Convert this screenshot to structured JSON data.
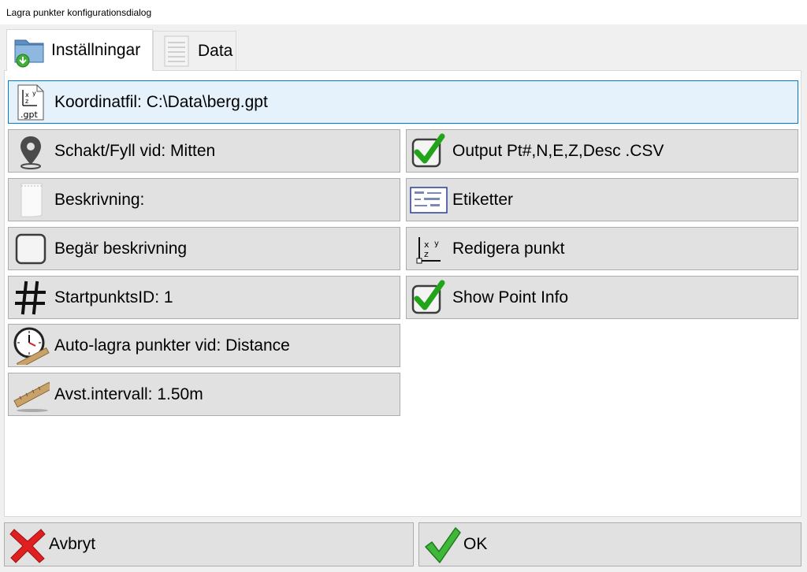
{
  "window": {
    "title": "Lagra punkter konfigurationsdialog"
  },
  "tabs": [
    {
      "label": "Inställningar",
      "icon": "folder-download-icon",
      "active": true
    },
    {
      "label": "Data",
      "icon": "data-sheet-icon",
      "active": false
    }
  ],
  "settings": {
    "coordinate_file": {
      "label": "Koordinatfil: C:\\Data\\berg.gpt",
      "icon": "gpt-file-icon",
      "icon_text": ".gpt"
    },
    "cut_fill": {
      "label": "Schakt/Fyll vid: Mitten",
      "icon": "map-pin-icon"
    },
    "description": {
      "label": "Beskrivning:",
      "icon": "note-page-icon"
    },
    "request_description": {
      "label": "Begär beskrivning",
      "icon": "checkbox-icon",
      "checked": false
    },
    "start_point_id": {
      "label": "StartpunktsID: 1",
      "icon": "hash-icon"
    },
    "auto_store": {
      "label": "Auto-lagra punkter vid: Distance",
      "icon": "clock-ruler-icon"
    },
    "distance_interval": {
      "label": "Avst.intervall: 1.50m",
      "icon": "ruler-icon"
    },
    "output_csv": {
      "label": "Output Pt#,N,E,Z,Desc .CSV",
      "icon": "checkbox-checked-icon",
      "checked": true
    },
    "labels": {
      "label": "Etiketter",
      "icon": "label-preview-icon"
    },
    "edit_point": {
      "label": "Redigera punkt",
      "icon": "xyz-axes-icon"
    },
    "show_point_info": {
      "label": "Show Point Info",
      "icon": "checkbox-checked-icon",
      "checked": true
    }
  },
  "footer": {
    "cancel": {
      "label": "Avbryt",
      "icon": "red-x-icon"
    },
    "ok": {
      "label": "OK",
      "icon": "green-check-icon"
    }
  },
  "colors": {
    "accent_border": "#0078d7",
    "highlight_bg": "#e5f1fb",
    "button_bg": "#e1e1e1",
    "check_green": "#22a31a",
    "cancel_red": "#e02020"
  }
}
